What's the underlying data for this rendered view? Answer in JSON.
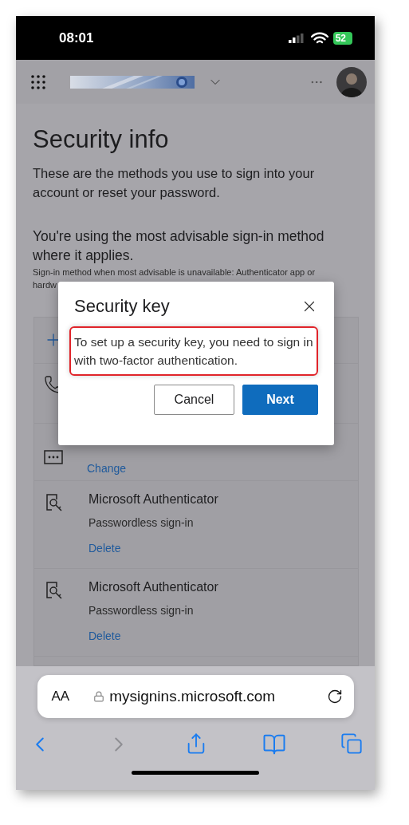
{
  "status_bar": {
    "time": "08:01",
    "battery": "52"
  },
  "page": {
    "title": "Security info",
    "description": "These are the methods you use to sign into your account or reset your password.",
    "notice": "You're using the most advisable sign-in method where it applies.",
    "fallback_lines": [
      "Sign-in method when most advisable is unavailable: Authenticator app or",
      "hardw"
    ]
  },
  "methods": [
    {
      "kind": "add"
    },
    {
      "kind": "phone"
    },
    {
      "kind": "other",
      "action": "Change"
    },
    {
      "kind": "authenticator",
      "title": "Microsoft Authenticator",
      "subtitle": "Passwordless sign-in",
      "action": "Delete"
    },
    {
      "kind": "authenticator",
      "title": "Microsoft Authenticator",
      "subtitle": "Passwordless sign-in",
      "action": "Delete"
    }
  ],
  "dialog": {
    "title": "Security key",
    "message": "To set up a security key, you need to sign in with two-factor authentication.",
    "buttons": [
      {
        "label": "Cancel",
        "kind": "secondary"
      },
      {
        "label": "Next",
        "kind": "primary"
      }
    ]
  },
  "browser": {
    "text_size": "AA",
    "url": "mysignins.microsoft.com"
  }
}
